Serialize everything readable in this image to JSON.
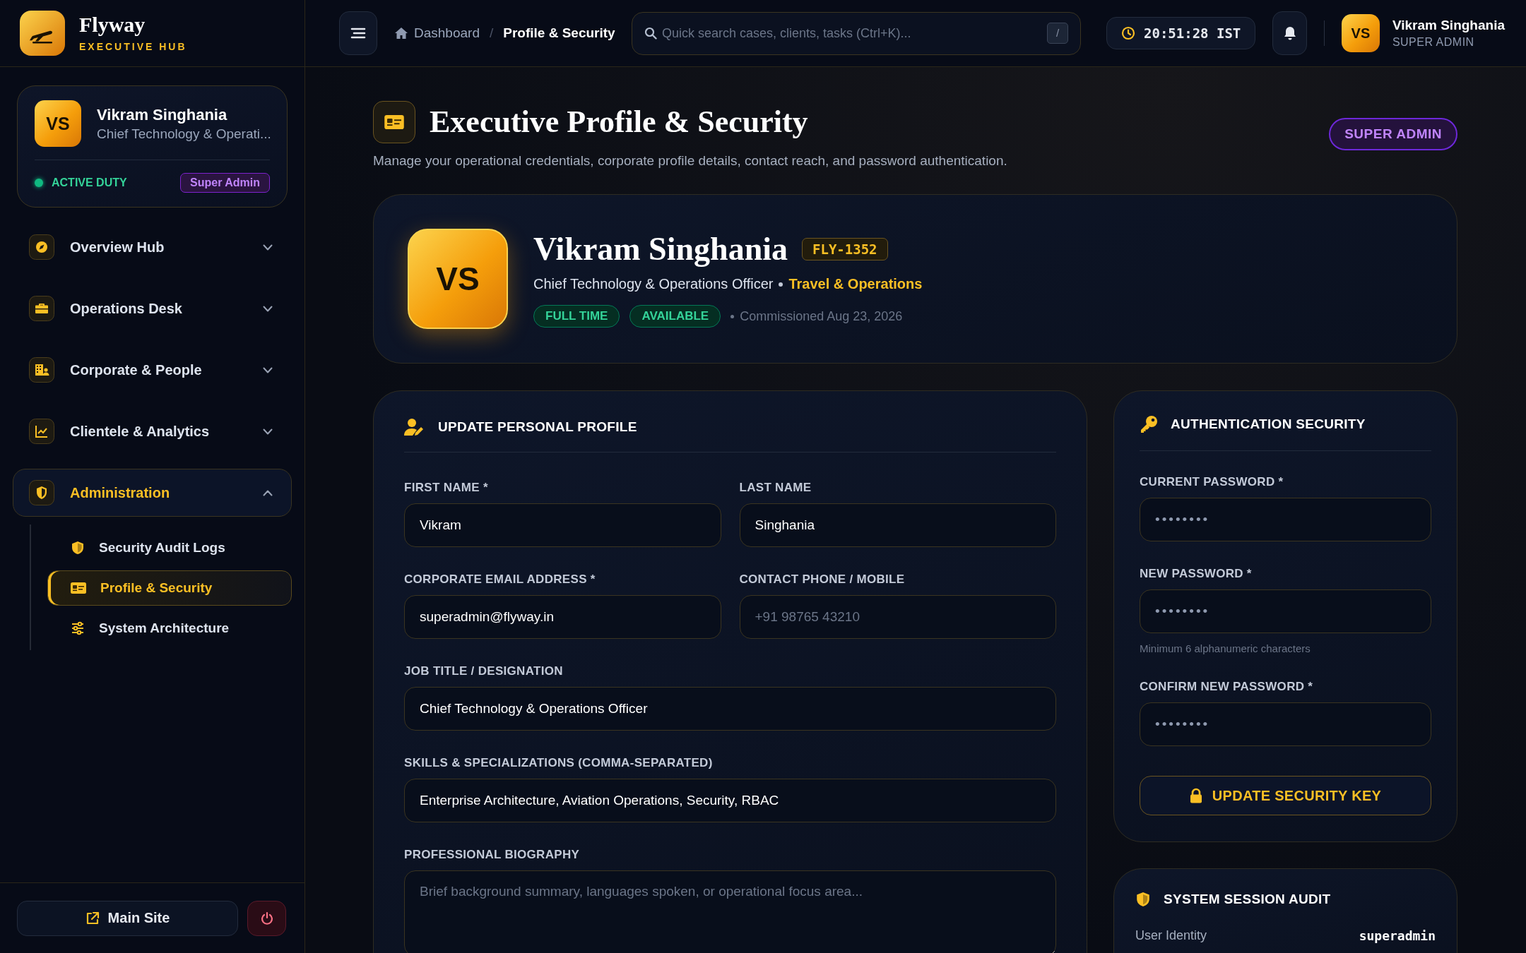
{
  "brand": {
    "name": "Flyway",
    "tagline": "EXECUTIVE HUB"
  },
  "topbar": {
    "breadcrumb": [
      {
        "label": "Dashboard",
        "selected": false
      },
      {
        "label": "Profile & Security",
        "selected": true
      }
    ],
    "separator": "/",
    "search": {
      "placeholder": "Quick search cases, clients, tasks (Ctrl+K)...",
      "shortcut": "/"
    },
    "clock": "20:51:28 IST",
    "user": {
      "initials": "VS",
      "name": "Vikram Singhania",
      "role": "SUPER ADMIN"
    }
  },
  "sidebar": {
    "profile": {
      "initials": "VS",
      "name": "Vikram Singhania",
      "title": "Chief Technology & Operati...",
      "status": "ACTIVE DUTY",
      "badge": "Super Admin"
    },
    "nav": [
      {
        "label": "Overview Hub",
        "expanded": false,
        "selected": false
      },
      {
        "label": "Operations Desk",
        "expanded": false,
        "selected": false
      },
      {
        "label": "Corporate & People",
        "expanded": false,
        "selected": false
      },
      {
        "label": "Clientele & Analytics",
        "expanded": false,
        "selected": false
      },
      {
        "label": "Administration",
        "expanded": true,
        "selected": true,
        "children": [
          {
            "label": "Security Audit Logs",
            "selected": false
          },
          {
            "label": "Profile & Security",
            "selected": true
          },
          {
            "label": "System Architecture",
            "selected": false
          }
        ]
      }
    ],
    "footer": {
      "link": "Main Site"
    }
  },
  "page": {
    "title": "Executive Profile & Security",
    "subtitle": "Manage your operational credentials, corporate profile details, contact reach, and password authentication.",
    "role_badge": "SUPER ADMIN"
  },
  "profile_card": {
    "initials": "VS",
    "name": "Vikram Singhania",
    "id": "FLY-1352",
    "title": "Chief Technology & Operations Officer",
    "department": "Travel & Operations",
    "tags": [
      "FULL TIME",
      "AVAILABLE"
    ],
    "commissioned": "Commissioned Aug 23, 2026"
  },
  "profile_form": {
    "title": "UPDATE PERSONAL PROFILE",
    "fields": [
      {
        "kind": "half",
        "label": "FIRST NAME *",
        "value": "Vikram"
      },
      {
        "kind": "half",
        "label": "LAST NAME",
        "value": "Singhania"
      },
      {
        "kind": "half",
        "label": "CORPORATE EMAIL ADDRESS *",
        "value": "superadmin@flyway.in"
      },
      {
        "kind": "half",
        "label": "CONTACT PHONE / MOBILE",
        "placeholder": "+91 98765 43210"
      },
      {
        "kind": "wide",
        "label": "JOB TITLE / DESIGNATION",
        "value": "Chief Technology & Operations Officer"
      },
      {
        "kind": "wide",
        "label": "SKILLS & SPECIALIZATIONS (COMMA-SEPARATED)",
        "value": "Enterprise Architecture, Aviation Operations, Security, RBAC"
      },
      {
        "kind": "textarea",
        "label": "PROFESSIONAL BIOGRAPHY",
        "placeholder": "Brief background summary, languages spoken, or operational focus area..."
      }
    ]
  },
  "security": {
    "title": "AUTHENTICATION SECURITY",
    "fields": [
      {
        "label": "CURRENT PASSWORD *",
        "value": "••••••••"
      },
      {
        "label": "NEW PASSWORD *",
        "value": "••••••••",
        "hint": "Minimum 6 alphanumeric characters"
      },
      {
        "label": "CONFIRM NEW PASSWORD *",
        "value": "••••••••"
      }
    ],
    "button": "UPDATE SECURITY KEY"
  },
  "session_audit": {
    "title": "SYSTEM SESSION AUDIT",
    "rows": [
      {
        "label": "User Identity",
        "value": "superadmin"
      }
    ]
  }
}
